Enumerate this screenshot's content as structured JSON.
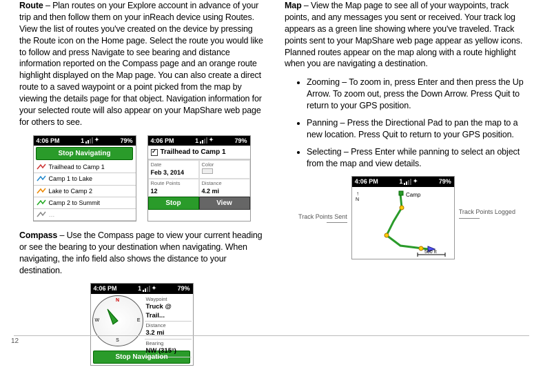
{
  "left": {
    "route": {
      "title": "Route",
      "body": " – Plan routes on your Explore account in advance of your trip and then follow them on your inReach device using Routes. View the list of routes you've created on the device by pressing the Route icon on the Home page. Select the route you would like to follow and press Navigate to see bearing and distance information reported on the Compass page and an orange route highlight displayed on the Map page. You can also create a direct route to a saved waypoint or a point picked from the map by viewing the details page for that object. Navigation information for your selected route will also appear on your MapShare web page for others to see."
    },
    "compass": {
      "title": "Compass",
      "body": " – Use the Compass page to view your current heading or see the bearing to your destination when navigating. When navigating, the info field also shows the distance to your destination."
    },
    "fig1": {
      "status": {
        "time": "4:06 PM",
        "sig": "1",
        "batt": "79%"
      },
      "btn": "Stop Navigating",
      "items": [
        "Trailhead to Camp 1",
        "Camp 1 to Lake",
        "Lake to Camp 2",
        "Camp 2 to Summit"
      ]
    },
    "fig2": {
      "status": {
        "time": "4:06 PM",
        "sig": "1",
        "batt": "79%"
      },
      "header": "Trailhead to Camp 1",
      "date_l": "Date",
      "date_v": "Feb 3, 2014",
      "color_l": "Color",
      "rp_l": "Route Points",
      "rp_v": "12",
      "dist_l": "Distance",
      "dist_v": "4.2 mi",
      "stop": "Stop",
      "view": "View"
    },
    "fig3": {
      "status": {
        "time": "4:06 PM",
        "sig": "1",
        "batt": "79%"
      },
      "wp_l": "Waypoint",
      "wp_v": "Truck @ Trail...",
      "dist_l": "Distance",
      "dist_v": "3.2 mi",
      "bear_l": "Bearing",
      "bear_v": "NW (315°)",
      "btn": "Stop Navigation",
      "dirs": {
        "n": "N",
        "e": "E",
        "s": "S",
        "w": "W"
      }
    }
  },
  "right": {
    "map": {
      "title": "Map",
      "body": " – View the Map page to see all of your waypoints, track points, and any messages you sent or received. Your track log appears as a green line showing where you've traveled. Track points sent to your MapShare web page appear as yellow icons. Planned routes appear on the map along with a route highlight when you are navigating a destination."
    },
    "bullets": {
      "zoom_t": "Zooming",
      "zoom_b": " – To zoom in, press Enter and then press the Up Arrow. To zoom out, press the Down Arrow. Press Quit to return to your GPS position.",
      "pan_t": "Panning",
      "pan_b": " – Press the Directional Pad to pan the map to a new location. Press Quit to return to your GPS position.",
      "sel_t": "Selecting",
      "sel_b": " – Press Enter while panning to select an object from the map and view details."
    },
    "mapfig": {
      "status": {
        "time": "4:06 PM",
        "sig": "1",
        "batt": "79%"
      },
      "ann_sent": "Track Points Sent",
      "ann_logged": "Track Points Logged",
      "camp": "Camp",
      "scale": "500 ft",
      "n": "N"
    }
  },
  "page_number": "12"
}
